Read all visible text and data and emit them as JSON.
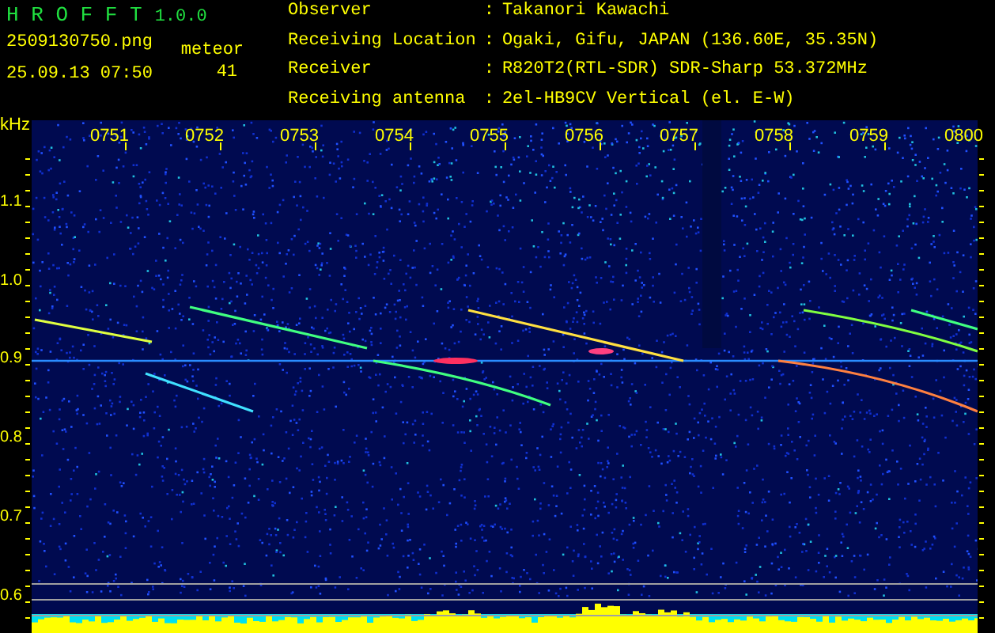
{
  "app": {
    "name": "H R O F F T",
    "version": "1.0.0"
  },
  "file": {
    "name": "2509130750.png",
    "datetime": "25.09.13 07:50"
  },
  "meteor": {
    "label": "meteor",
    "count": "41"
  },
  "station": [
    {
      "label": "Observer",
      "separator": ":",
      "value": "Takanori Kawachi"
    },
    {
      "label": "Receiving Location",
      "separator": ":",
      "value": "Ogaki, Gifu, JAPAN (136.60E, 35.35N)"
    },
    {
      "label": "Receiver",
      "separator": ":",
      "value": "R820T2(RTL-SDR) SDR-Sharp 53.372MHz"
    },
    {
      "label": "Receiving antenna",
      "separator": ":",
      "value": "2el-HB9CV Vertical (el. E-W)"
    }
  ],
  "spectrogram": {
    "unit": "kHz",
    "time_labels": [
      "0751",
      "0752",
      "0753",
      "0754",
      "0755",
      "0756",
      "0757",
      "0758",
      "0759",
      "0800"
    ],
    "freq_labels": [
      "1.1",
      "1.0",
      "0.9",
      "0.8",
      "0.7",
      "0.6"
    ]
  }
}
